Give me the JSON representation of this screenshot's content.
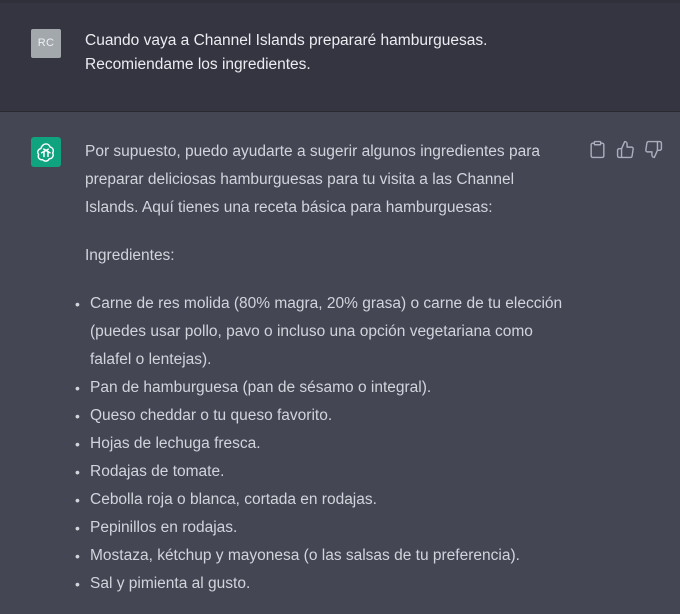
{
  "user": {
    "avatar_initials": "RC",
    "lines": [
      "Cuando vaya a Channel Islands prepararé hamburguesas.",
      "Recomiendame los ingredientes."
    ]
  },
  "assistant": {
    "intro_lines": [
      "Por supuesto, puedo ayudarte a sugerir algunos ingredientes para",
      "preparar deliciosas hamburguesas para tu visita a las Channel",
      "Islands. Aquí tienes una receta básica para hamburguesas:"
    ],
    "heading": "Ingredientes:",
    "items": [
      {
        "lines": [
          "Carne de res molida (80% magra, 20% grasa) o carne de tu elección",
          "(puedes usar pollo, pavo o incluso una opción vegetariana como",
          "falafel o lentejas)."
        ]
      },
      {
        "lines": [
          "Pan de hamburguesa (pan de sésamo o integral)."
        ]
      },
      {
        "lines": [
          "Queso cheddar o tu queso favorito."
        ]
      },
      {
        "lines": [
          "Hojas de lechuga fresca."
        ]
      },
      {
        "lines": [
          "Rodajas de tomate."
        ]
      },
      {
        "lines": [
          "Cebolla roja o blanca, cortada en rodajas."
        ]
      },
      {
        "lines": [
          "Pepinillos en rodajas."
        ]
      },
      {
        "lines": [
          "Mostaza, kétchup y mayonesa (o las salsas de tu preferencia)."
        ]
      },
      {
        "lines": [
          "Sal y pimienta al gusto."
        ]
      }
    ]
  },
  "icons": {
    "assistant_avatar": "openai-logo-icon",
    "copy": "clipboard-icon",
    "like": "thumbs-up-icon",
    "dislike": "thumbs-down-icon"
  },
  "colors": {
    "user_bg": "#343541",
    "assistant_bg": "#444654",
    "assistant_avatar_bg": "#10a37f",
    "user_avatar_bg": "#a3a8ac"
  }
}
